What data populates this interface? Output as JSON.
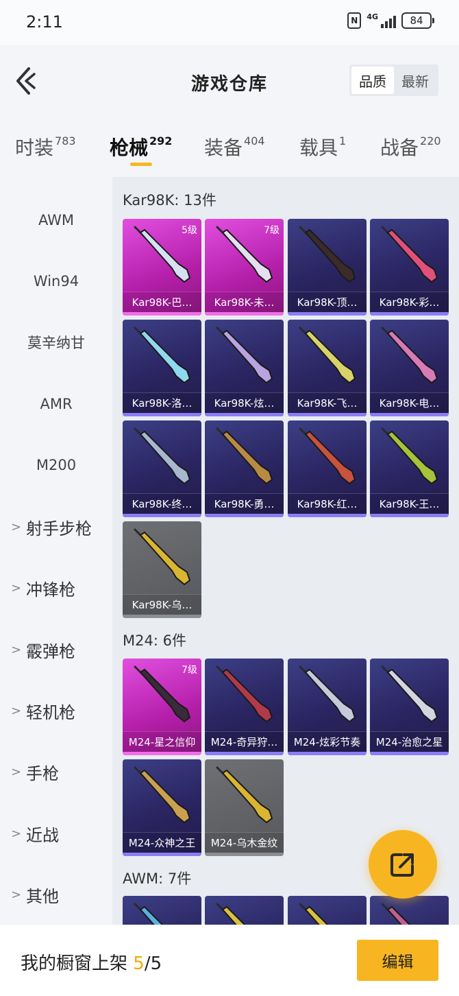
{
  "status": {
    "time": "2:11",
    "network": "4G",
    "battery": "84"
  },
  "header": {
    "title": "游戏仓库",
    "sort_options": [
      "品质",
      "最新"
    ]
  },
  "tabs": [
    {
      "label": "时装",
      "count": "783"
    },
    {
      "label": "枪械",
      "count": "292"
    },
    {
      "label": "装备",
      "count": "404"
    },
    {
      "label": "载具",
      "count": "1"
    },
    {
      "label": "战备",
      "count": "220"
    }
  ],
  "sidebar": {
    "items": [
      "AWM",
      "Win94",
      "莫辛纳甘",
      "AMR",
      "M200"
    ],
    "groups": [
      "射手步枪",
      "冲锋枪",
      "霰弹枪",
      "轻机枪",
      "手枪",
      "近战",
      "其他"
    ]
  },
  "sections": [
    {
      "title": "Kar98K: 13件",
      "items": [
        {
          "name": "Kar98K-巴…",
          "rarity": "pink",
          "level": "5级",
          "accent": "#d7dff2"
        },
        {
          "name": "Kar98K-未…",
          "rarity": "pink",
          "level": "7级",
          "accent": "#e6dff0"
        },
        {
          "name": "Kar98K-顶…",
          "rarity": "purple",
          "accent": "#3b2b2b"
        },
        {
          "name": "Kar98K-彩…",
          "rarity": "purple",
          "accent": "#e0507a"
        },
        {
          "name": "Kar98K-洛…",
          "rarity": "purple",
          "accent": "#8fd8f0"
        },
        {
          "name": "Kar98K-炫…",
          "rarity": "purple",
          "accent": "#b9a3e0"
        },
        {
          "name": "Kar98K-飞…",
          "rarity": "purple",
          "accent": "#d9d16a"
        },
        {
          "name": "Kar98K-电…",
          "rarity": "purple",
          "accent": "#d77ab8"
        },
        {
          "name": "Kar98K-终…",
          "rarity": "purple",
          "accent": "#a7b7d0"
        },
        {
          "name": "Kar98K-勇…",
          "rarity": "purple",
          "accent": "#b88a44"
        },
        {
          "name": "Kar98K-红…",
          "rarity": "purple",
          "accent": "#c7523d"
        },
        {
          "name": "Kar98K-王…",
          "rarity": "purple",
          "accent": "#a8c23c"
        },
        {
          "name": "Kar98K-乌…",
          "rarity": "gray",
          "accent": "#d9b531"
        }
      ]
    },
    {
      "title": "M24: 6件",
      "items": [
        {
          "name": "M24-星之信仰",
          "rarity": "pink",
          "level": "7级",
          "accent": "#3a2a3a"
        },
        {
          "name": "M24-奇异狩…",
          "rarity": "purple",
          "accent": "#b03a4a"
        },
        {
          "name": "M24-炫彩节奏",
          "rarity": "purple",
          "accent": "#c5c9dc"
        },
        {
          "name": "M24-治愈之星",
          "rarity": "purple",
          "accent": "#d3d5e0"
        },
        {
          "name": "M24-众神之王",
          "rarity": "purple",
          "accent": "#c9a050"
        },
        {
          "name": "M24-乌木金纹",
          "rarity": "gray",
          "accent": "#d9b531"
        }
      ]
    },
    {
      "title": "AWM: 7件",
      "items": [
        {
          "name": "",
          "rarity": "purple",
          "accent": "#5ab0e0"
        },
        {
          "name": "",
          "rarity": "purple",
          "accent": "#d8c040"
        },
        {
          "name": "",
          "rarity": "purple",
          "accent": "#d8c040"
        },
        {
          "name": "",
          "rarity": "purple",
          "accent": "#c06090"
        }
      ]
    }
  ],
  "bottom": {
    "text": "我的橱窗上架 ",
    "current": "5",
    "total": "/5",
    "edit_label": "编辑"
  },
  "colors": {
    "accent": "#f7b521",
    "purple_card": "#2a2460",
    "pink_card": "#b31ea8",
    "gray_card": "#55575b"
  }
}
